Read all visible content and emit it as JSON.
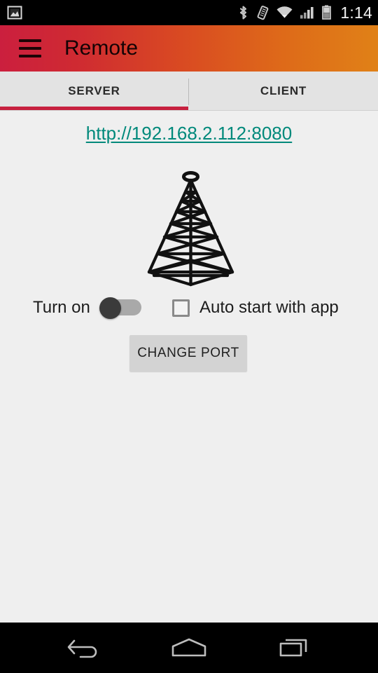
{
  "status_bar": {
    "notification_icon": "image-notification-icon",
    "icons": [
      "bluetooth-icon",
      "vibrate-icon",
      "wifi-icon",
      "cellular-signal-icon",
      "battery-icon"
    ],
    "clock": "1:14"
  },
  "app_bar": {
    "menu_icon": "hamburger-menu-icon",
    "title": "Remote",
    "gradient_start": "#cb1f3e",
    "gradient_end": "#e08117",
    "title_color": "#140305"
  },
  "tabs": {
    "items": [
      {
        "label": "SERVER",
        "selected": true
      },
      {
        "label": "CLIENT",
        "selected": false
      }
    ],
    "indicator_color": "#c7213f"
  },
  "content": {
    "server_url": "http://192.168.2.112:8080",
    "server_url_color": "#00897b",
    "illustration": "radio-tower-icon",
    "turn_on_label": "Turn on",
    "switch_state": "off",
    "switch_thumb_color": "#3b3b3b",
    "switch_track_color": "#a9a9a9",
    "autostart_label": "Auto start with app",
    "autostart_checked": false,
    "change_port_label": "CHANGE PORT",
    "background_color": "#efefef"
  },
  "nav_bar": {
    "buttons": [
      "back-icon",
      "home-icon",
      "recents-icon"
    ]
  }
}
